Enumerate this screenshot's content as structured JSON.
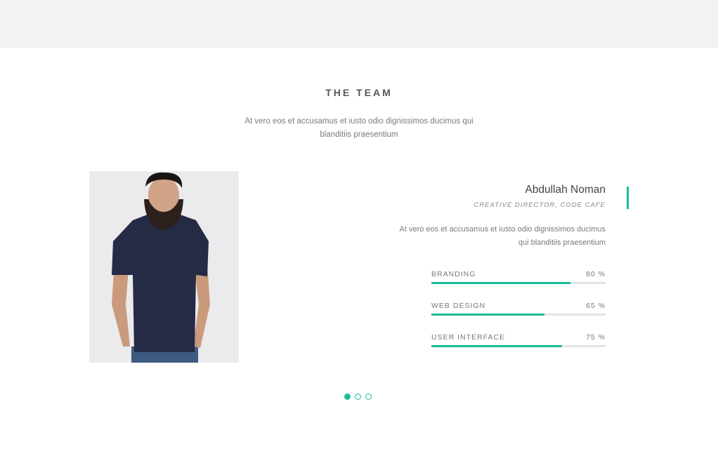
{
  "section": {
    "title": "THE TEAM",
    "subtitle": "At vero eos et accusamus et iusto odio dignissimos ducimus qui blanditiis praesentium"
  },
  "member": {
    "name": "Abdullah Noman",
    "role": "CREATIVE DIRECTOR, CODE CAFE",
    "bio": "At vero eos et accusamus et iusto odio dignissimos ducimus qui blanditiis praesentium",
    "skills": [
      {
        "name": "BRANDING",
        "value_label": "80 %",
        "percent": 80
      },
      {
        "name": "WEB DESIGN",
        "value_label": "65 %",
        "percent": 65
      },
      {
        "name": "USER INTERFACE",
        "value_label": "75 %",
        "percent": 75
      }
    ]
  },
  "carousel": {
    "page_count": 3,
    "active_index": 0
  },
  "colors": {
    "accent": "#1abc9c",
    "top_band": "#f2f2f2"
  }
}
